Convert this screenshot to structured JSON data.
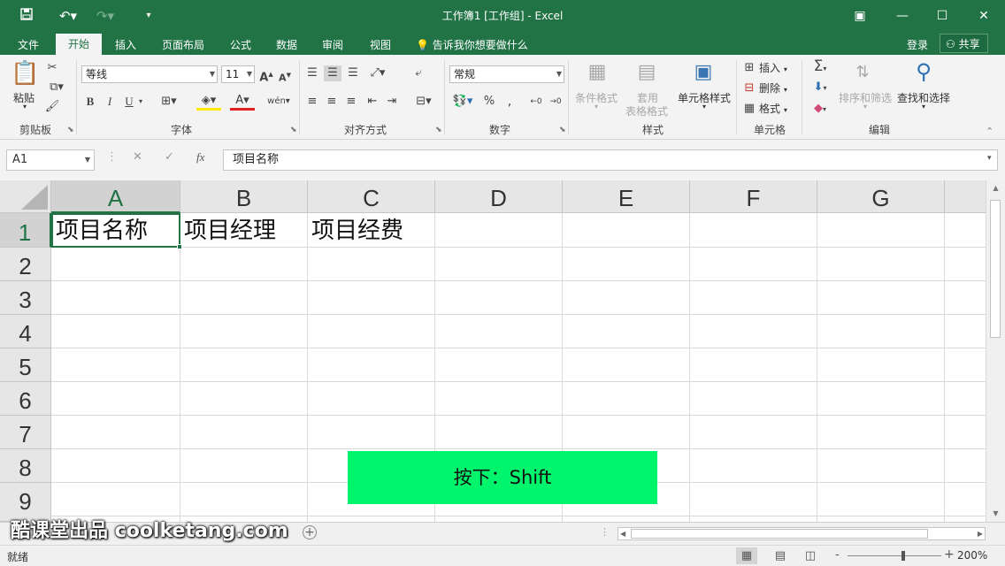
{
  "window": {
    "title": "工作簿1  [工作组] - Excel",
    "accent": "#217346"
  },
  "quick_access": {
    "save_icon": "save-icon",
    "undo_icon": "undo-icon",
    "redo_icon": "redo-icon",
    "customize_icon": "customize-icon"
  },
  "tabs": [
    "文件",
    "开始",
    "插入",
    "页面布局",
    "公式",
    "数据",
    "审阅",
    "视图"
  ],
  "active_tab": "开始",
  "tell_me": "告诉我你想要做什么",
  "account": {
    "login": "登录",
    "share": "共享"
  },
  "ribbon": {
    "clipboard": {
      "label": "剪贴板",
      "paste": "粘贴"
    },
    "font": {
      "label": "字体",
      "font_name": "等线",
      "font_size": "11",
      "bold": "B",
      "italic": "I",
      "underline": "U"
    },
    "alignment": {
      "label": "对齐方式"
    },
    "number": {
      "label": "数字",
      "format": "常规",
      "percent": "%"
    },
    "styles": {
      "label": "样式",
      "conditional": "条件格式",
      "table_format_1": "套用",
      "table_format_2": "表格格式",
      "cell_styles": "单元格样式"
    },
    "cells": {
      "label": "单元格",
      "insert": "插入",
      "delete": "删除",
      "format": "格式"
    },
    "editing": {
      "label": "编辑",
      "sort_filter": "排序和筛选",
      "find_select": "查找和选择"
    }
  },
  "formula_bar": {
    "name_box": "A1",
    "fx": "fx",
    "content": "项目名称"
  },
  "grid": {
    "columns": [
      "A",
      "B",
      "C",
      "D",
      "E",
      "F",
      "G"
    ],
    "rows": [
      "1",
      "2",
      "3",
      "4",
      "5",
      "6",
      "7",
      "8",
      "9"
    ],
    "cells": {
      "A1": "项目名称",
      "B1": "项目经理",
      "C1": "项目经费"
    },
    "selected": "A1"
  },
  "keypress_overlay": "按下：Shift",
  "watermark": "酷课堂出品 coolketang.com",
  "status": {
    "ready": "就绪",
    "zoom": "200%",
    "minus": "-",
    "plus": "+"
  }
}
